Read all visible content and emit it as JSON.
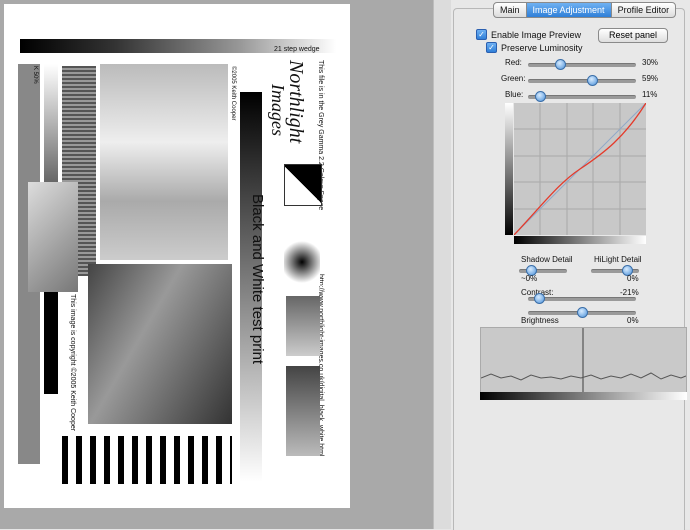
{
  "tabs": [
    "Main",
    "Image Adjustment",
    "Profile Editor"
  ],
  "active_tab": "Image Adjustment",
  "options": {
    "enable_preview": "Enable Image Preview",
    "preserve_luminosity": "Preserve Luminosity",
    "reset_button": "Reset panel"
  },
  "colour": {
    "red": {
      "label": "Red:",
      "value": "30%",
      "level": 0.3
    },
    "green": {
      "label": "Green:",
      "value": "59%",
      "level": 0.59
    },
    "blue": {
      "label": "Blue:",
      "value": "11%",
      "level": 0.11
    }
  },
  "detail": {
    "shadow": {
      "label": "Shadow Detail",
      "value": "~0%",
      "level": 0.25
    },
    "hilight": {
      "label": "HiLight Detail",
      "value": "0%",
      "level": 0.75
    },
    "contrast": {
      "label": "Contrast:",
      "value": "-21%",
      "level": 0.1
    },
    "brightness": {
      "label": "Brightness",
      "value": "0%",
      "level": 0.5
    }
  },
  "print": {
    "step_wedge": "21 step wedge",
    "logo_line1": "Northlight",
    "logo_line2": "Images",
    "gamma": "This file is in the Grey Gamma 2.2 Colour Space",
    "title": "Black and White test print",
    "url": "http://www.northlight-images.co.uk/digital_black_white.html",
    "copyright": "This image is copyright ©2005 Keith Cooper",
    "copyright_small": "©2005 Keith Cooper",
    "percent": "K 50%"
  },
  "colors": {
    "curve": "#e53a2a",
    "accent": "#3a86de"
  }
}
